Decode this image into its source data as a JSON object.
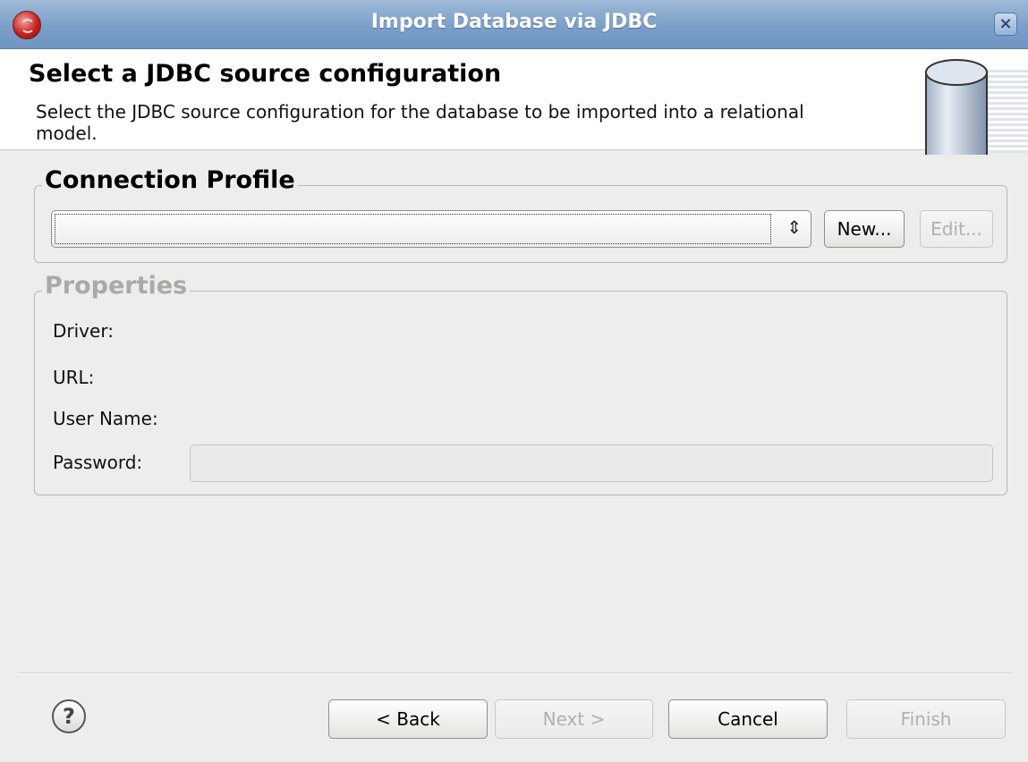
{
  "window": {
    "title": "Import Database via JDBC"
  },
  "header": {
    "title": "Select a JDBC source configuration",
    "description": "Select the JDBC source configuration for the database to be imported into a relational model.",
    "icon": "database-icon"
  },
  "connection_profile": {
    "legend": "Connection Profile",
    "selected": "",
    "new_label": "New...",
    "edit_label": "Edit..."
  },
  "properties": {
    "legend": "Properties",
    "driver_label": "Driver:",
    "url_label": "URL:",
    "user_name_label": "User Name:",
    "password_label": "Password:",
    "password_value": ""
  },
  "footer": {
    "back_label": "< Back",
    "next_label": "Next >",
    "cancel_label": "Cancel",
    "finish_label": "Finish"
  }
}
